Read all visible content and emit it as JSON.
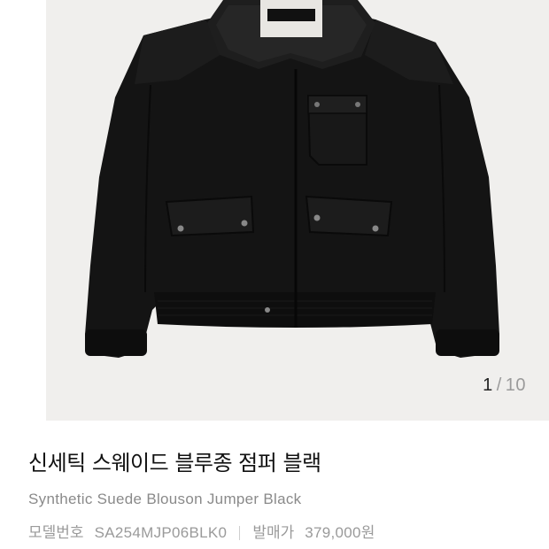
{
  "product": {
    "name_ko": "신세틱 스웨이드 블루종 점퍼 블랙",
    "name_en": "Synthetic Suede Blouson Jumper Black",
    "model_label": "모델번호",
    "model_number": "SA254MJP06BLK0",
    "release_price_label": "발매가",
    "release_price": "379,000원"
  },
  "gallery": {
    "current": "1",
    "separator": "/",
    "total": "10",
    "image_subject": "jacket-image"
  },
  "colors": {
    "image_bg": "#f0efed",
    "jacket": "#141414",
    "text_primary": "#111111",
    "text_secondary": "#8a8a8a"
  }
}
